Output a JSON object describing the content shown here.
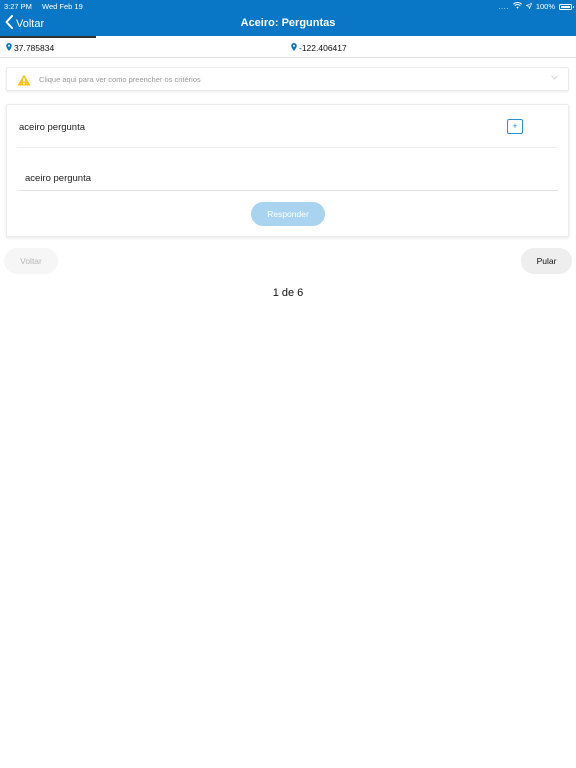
{
  "status_bar": {
    "time": "3:27 PM",
    "date": "Wed Feb 19",
    "signal_text": "....",
    "battery": "100%",
    "icons": [
      "wifi-icon",
      "location-arrow-icon",
      "battery-icon"
    ],
    "color": "#0a77c6"
  },
  "nav": {
    "back_label": "Voltar",
    "title": "Aceiro: Perguntas"
  },
  "location": {
    "latitude": "37.785834",
    "longitude": "-122.406417",
    "progress_fraction": 0.1667
  },
  "hint": {
    "text": "Clique aqui para ver como preencher os critérios",
    "warning_color": "#f5c518"
  },
  "question": {
    "title": "aceiro pergunta",
    "add_label": "+",
    "answer_value": "aceiro pergunta",
    "submit_label": "Responder"
  },
  "footer": {
    "back_label": "Voltar",
    "skip_label": "Pular",
    "pager": "1 de 6"
  }
}
